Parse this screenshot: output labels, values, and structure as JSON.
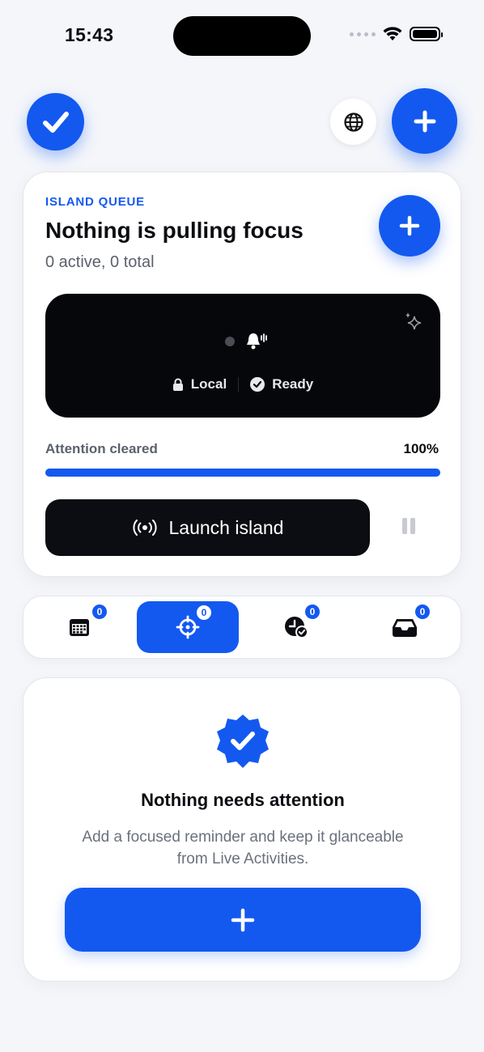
{
  "status_bar": {
    "time": "15:43",
    "icons": [
      "cellular-dots-icon",
      "wifi-icon",
      "battery-icon"
    ]
  },
  "header": {
    "left_button_icon": "checkmark-icon",
    "globe_button_icon": "globe-icon",
    "add_button_icon": "plus-icon"
  },
  "queue_card": {
    "eyebrow": "ISLAND QUEUE",
    "title": "Nothing is pulling focus",
    "subtitle": "0 active, 0 total",
    "add_icon": "plus-icon",
    "preview": {
      "sparkle_icon": "sparkle-icon",
      "bell_icon": "bell-ringing-icon",
      "local_label": "Local",
      "ready_label": "Ready"
    },
    "progress": {
      "label": "Attention cleared",
      "value_text": "100%",
      "fraction": 1.0
    },
    "launch_label": "Launch island",
    "launch_icon": "broadcast-icon",
    "pause_icon": "pause-icon"
  },
  "tabs": [
    {
      "icon": "calendar-icon",
      "badge": "0",
      "active": false
    },
    {
      "icon": "target-icon",
      "badge": "0",
      "active": true
    },
    {
      "icon": "clock-check-icon",
      "badge": "0",
      "active": false
    },
    {
      "icon": "inbox-icon",
      "badge": "0",
      "active": false
    }
  ],
  "empty_state": {
    "icon": "verified-badge-icon",
    "title": "Nothing needs attention",
    "line1": "Add a focused reminder and keep it glanceable",
    "line2": "from Live Activities.",
    "add_icon": "plus-icon"
  },
  "colors": {
    "accent": "#1359f0",
    "background": "#f4f6fa",
    "dark": "#0b0d12"
  }
}
